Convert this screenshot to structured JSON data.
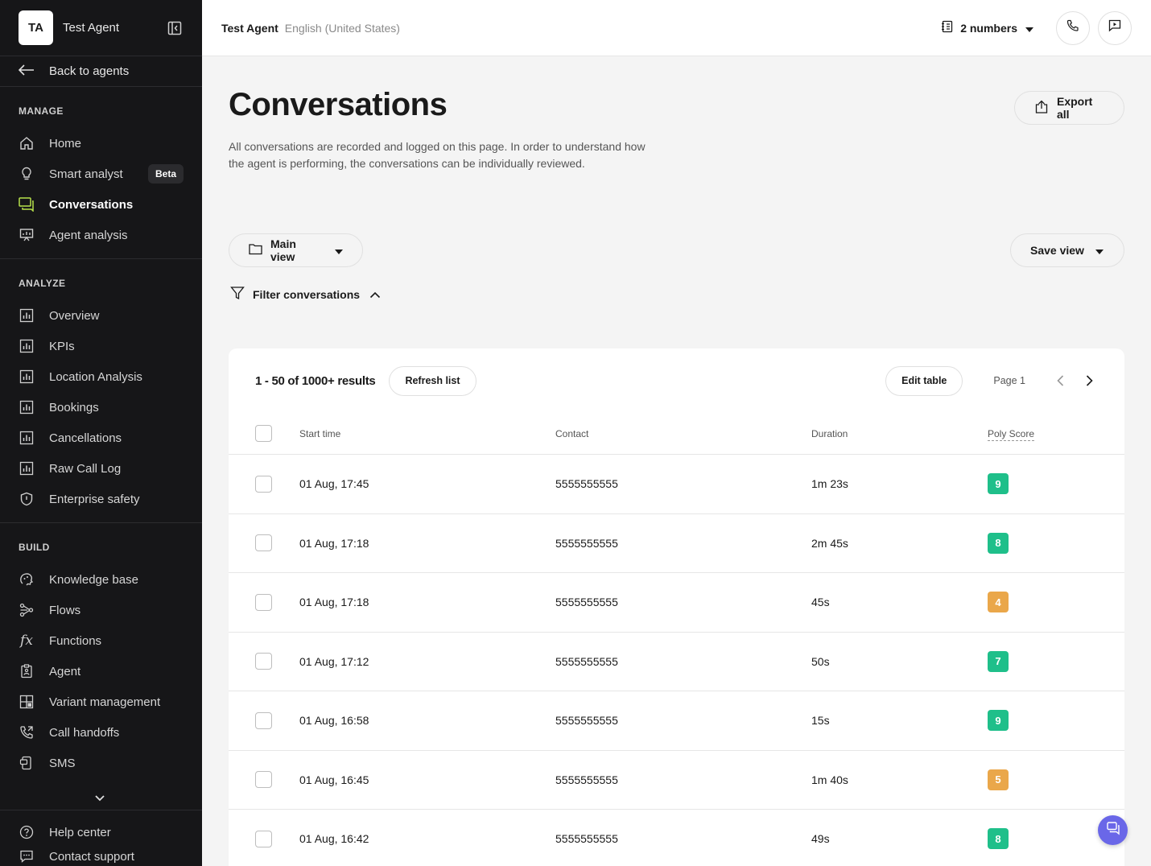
{
  "sidebar": {
    "avatar_initials": "TA",
    "agent_name": "Test Agent",
    "back_label": "Back to agents",
    "manage": {
      "title": "MANAGE",
      "items": [
        {
          "label": "Home",
          "icon": "home-icon"
        },
        {
          "label": "Smart analyst",
          "icon": "lightbulb-icon",
          "badge": "Beta"
        },
        {
          "label": "Conversations",
          "icon": "conversations-icon",
          "active": true
        },
        {
          "label": "Agent analysis",
          "icon": "presentation-icon"
        }
      ]
    },
    "analyze": {
      "title": "ANALYZE",
      "items": [
        {
          "label": "Overview"
        },
        {
          "label": "KPIs"
        },
        {
          "label": "Location Analysis"
        },
        {
          "label": "Bookings"
        },
        {
          "label": "Cancellations"
        },
        {
          "label": "Raw Call Log"
        },
        {
          "label": "Enterprise safety"
        }
      ]
    },
    "build": {
      "title": "BUILD",
      "items": [
        {
          "label": "Knowledge base"
        },
        {
          "label": "Flows"
        },
        {
          "label": "Functions"
        },
        {
          "label": "Agent"
        },
        {
          "label": "Variant management"
        },
        {
          "label": "Call handoffs"
        },
        {
          "label": "SMS"
        }
      ]
    },
    "bottom": [
      {
        "label": "Help center"
      },
      {
        "label": "Contact support"
      }
    ]
  },
  "topbar": {
    "agent_name": "Test Agent",
    "language": "English (United States)",
    "numbers_label": "2 numbers"
  },
  "page": {
    "title": "Conversations",
    "description": "All conversations are recorded and logged on this page. In order to understand how the agent is performing, the conversations can be individually reviewed.",
    "export_label": "Export all",
    "main_view_label": "Main view",
    "save_view_label": "Save view",
    "filter_label": "Filter conversations"
  },
  "table": {
    "results_label": "1 - 50 of 1000+ results",
    "refresh_label": "Refresh list",
    "edit_table_label": "Edit table",
    "page_label": "Page 1",
    "columns": {
      "start_time": "Start time",
      "contact": "Contact",
      "duration": "Duration",
      "poly_score": "Poly Score"
    },
    "rows": [
      {
        "start_time": "01 Aug, 17:45",
        "contact": "5555555555",
        "duration": "1m 23s",
        "score": "9",
        "color": "#1fbf8a"
      },
      {
        "start_time": "01 Aug, 17:18",
        "contact": "5555555555",
        "duration": "2m 45s",
        "score": "8",
        "color": "#1fbf8a"
      },
      {
        "start_time": "01 Aug, 17:18",
        "contact": "5555555555",
        "duration": "45s",
        "score": "4",
        "color": "#eaa74a"
      },
      {
        "start_time": "01 Aug, 17:12",
        "contact": "5555555555",
        "duration": "50s",
        "score": "7",
        "color": "#1fbf8a"
      },
      {
        "start_time": "01 Aug, 16:58",
        "contact": "5555555555",
        "duration": "15s",
        "score": "9",
        "color": "#1fbf8a"
      },
      {
        "start_time": "01 Aug, 16:45",
        "contact": "5555555555",
        "duration": "1m 40s",
        "score": "5",
        "color": "#eaa74a"
      },
      {
        "start_time": "01 Aug, 16:42",
        "contact": "5555555555",
        "duration": "49s",
        "score": "8",
        "color": "#1fbf8a"
      }
    ]
  },
  "colors": {
    "accent_active": "#b6e04a",
    "score_good": "#1fbf8a",
    "score_medium": "#eaa74a",
    "chat_fab": "#6a67e8"
  }
}
